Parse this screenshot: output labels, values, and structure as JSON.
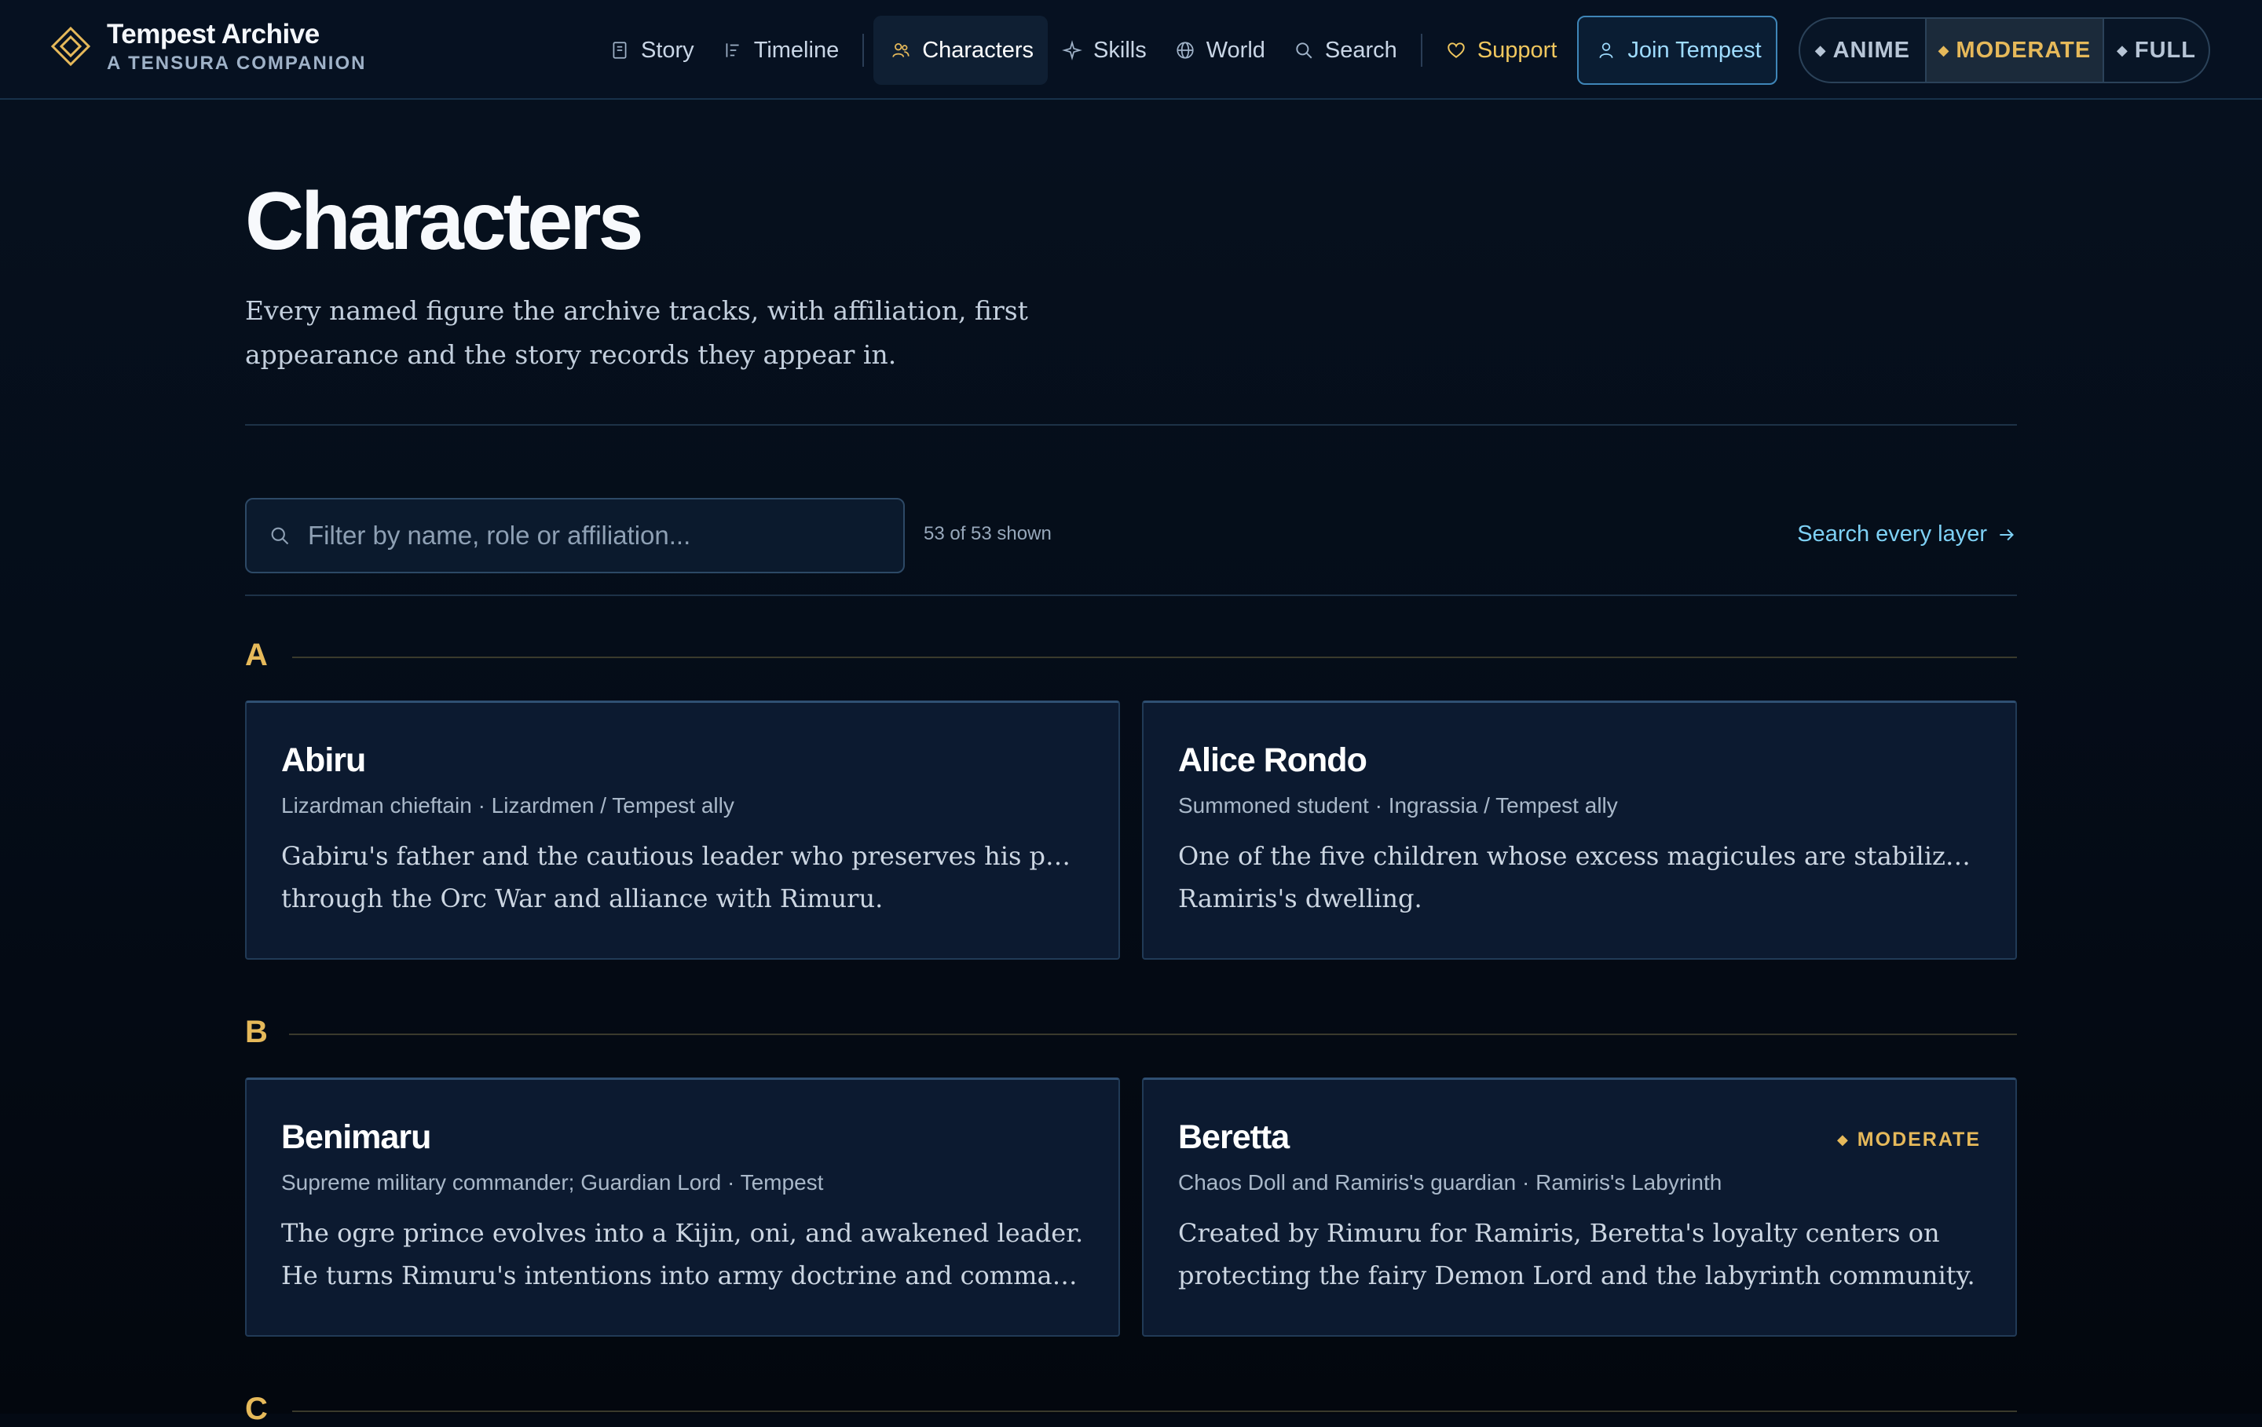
{
  "brand": {
    "title": "Tempest Archive",
    "subtitle": "A TENSURA COMPANION"
  },
  "nav": {
    "items": [
      {
        "label": "Story",
        "icon": "book-icon"
      },
      {
        "label": "Timeline",
        "icon": "timeline-icon"
      },
      {
        "label": "Characters",
        "icon": "people-icon",
        "active": true
      },
      {
        "label": "Skills",
        "icon": "sparkle-icon"
      },
      {
        "label": "World",
        "icon": "globe-icon"
      },
      {
        "label": "Search",
        "icon": "search-icon"
      }
    ],
    "support_label": "Support",
    "join_label": "Join Tempest"
  },
  "spoiler_mode": {
    "options": [
      "ANIME",
      "MODERATE",
      "FULL"
    ],
    "selected": "MODERATE"
  },
  "page": {
    "title": "Characters",
    "description": "Every named figure the archive tracks, with affiliation, first appearance and the story records they appear in."
  },
  "filter": {
    "placeholder": "Filter by name, role or affiliation...",
    "count": "53 of 53 shown",
    "search_all_label": "Search every layer"
  },
  "sections": [
    {
      "letter": "A",
      "cards": [
        {
          "name": "Abiru",
          "role": "Lizardman chieftain · Lizardmen / Tempest ally",
          "desc1": "Gabiru's father and the cautious leader who preserves his people",
          "desc2": "through the Orc War and alliance with Rimuru."
        },
        {
          "name": "Alice Rondo",
          "role": "Summoned student · Ingrassia / Tempest ally",
          "desc1": "One of the five children whose excess magicules are stabilized in",
          "desc2": "Ramiris's dwelling."
        }
      ]
    },
    {
      "letter": "B",
      "cards": [
        {
          "name": "Benimaru",
          "role": "Supreme military commander; Guardian Lord · Tempest",
          "desc1": "The ogre prince evolves into a Kijin, oni, and awakened leader.",
          "desc2": "He turns Rimuru's intentions into army doctrine and command and control..."
        },
        {
          "name": "Beretta",
          "role": "Chaos Doll and Ramiris's guardian · Ramiris's Labyrinth",
          "desc1": "Created by Rimuru for Ramiris, Beretta's loyalty centers on",
          "desc2": "protecting the fairy Demon Lord and the labyrinth community.",
          "badge": "MODERATE"
        }
      ]
    },
    {
      "letter": "C"
    }
  ],
  "colors": {
    "accent_gold": "#e6b95a",
    "accent_cyan": "#7ed1f5",
    "card_bg": "#0c1a30",
    "page_bg": "#050d19"
  }
}
